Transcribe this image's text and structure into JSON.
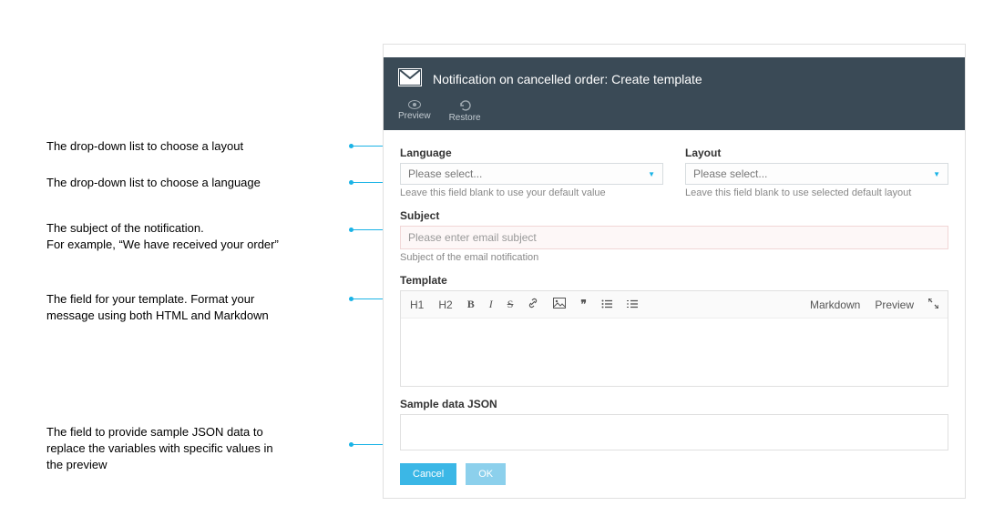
{
  "annotations": {
    "layout": "The drop-down list to choose a layout",
    "language": "The drop-down list to choose a language",
    "subject_l1": "The subject of the notification.",
    "subject_l2": "For example, “We have received your order”",
    "template_l1": "The field for your template. Format your",
    "template_l2": "message using both HTML and Markdown",
    "json_l1": "The field to provide sample JSON data to",
    "json_l2": "replace the variables with specific values in",
    "json_l3": "the preview"
  },
  "header": {
    "title": "Notification on cancelled order: Create template"
  },
  "subbar": {
    "preview": "Preview",
    "restore": "Restore"
  },
  "fields": {
    "language_label": "Language",
    "language_placeholder": "Please select...",
    "language_help": "Leave this field blank to use your default value",
    "layout_label": "Layout",
    "layout_placeholder": "Please select...",
    "layout_help": "Leave this field blank to use selected default layout",
    "subject_label": "Subject",
    "subject_placeholder": "Please enter email subject",
    "subject_help": "Subject of the email notification",
    "template_label": "Template",
    "json_label": "Sample data JSON"
  },
  "toolbar": {
    "h1": "H1",
    "h2": "H2",
    "bold": "B",
    "italic": "I",
    "strike": "S",
    "link": "🔗",
    "image": "🖼",
    "quote": "❝❞",
    "ul": "☰",
    "ol": "≡",
    "markdown": "Markdown",
    "preview": "Preview",
    "expand": "⤡"
  },
  "footer": {
    "cancel": "Cancel",
    "ok": "OK"
  }
}
